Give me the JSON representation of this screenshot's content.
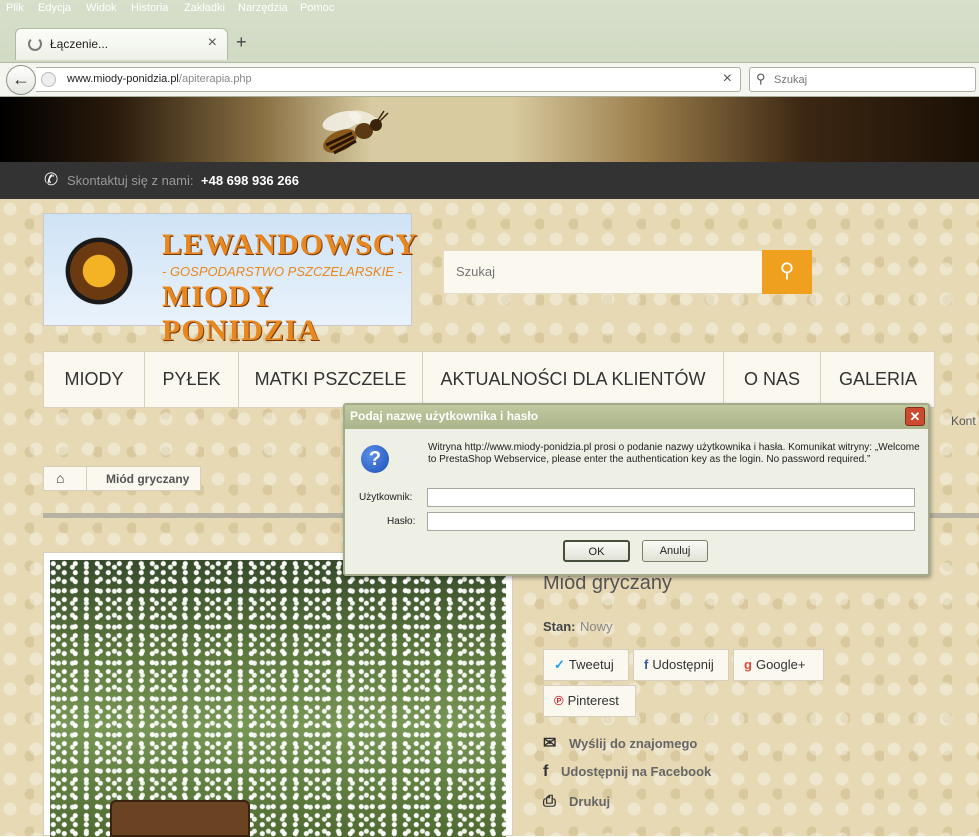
{
  "browser": {
    "menu": [
      "Plik",
      "Edycja",
      "Widok",
      "Historia",
      "Zakładki",
      "Narzędzia",
      "Pomoc"
    ],
    "tab_title": "Łączenie...",
    "tab_close": "×",
    "new_tab": "+",
    "back": "←",
    "url_domain": "www.miody-ponidzia.pl",
    "url_path": "/apiterapia.php",
    "url_clear": "×",
    "search_placeholder": "Szukaj"
  },
  "site": {
    "contact_label": "Skontaktuj się z nami:",
    "contact_phone": "+48 698 936 266",
    "logo_line1": "LEWANDOWSCY",
    "logo_line2": "- GOSPODARSTWO PSZCZELARSKIE -",
    "logo_line3": "MIODY PONIDZIA",
    "search_placeholder": "Szukaj",
    "menu": [
      "MIODY",
      "PYŁEK",
      "MATKI PSZCZELE",
      "AKTUALNOŚCI DLA KLIENTÓW",
      "O NAS",
      "GALERIA"
    ],
    "side_text": "Kont",
    "breadcrumb_current": "Miód gryczany",
    "product_title": "Miód gryczany",
    "condition_label": "Stan:",
    "condition_value": "Nowy",
    "share": {
      "twitter": "Tweetuj",
      "facebook": "Udostępnij",
      "google": "Google+",
      "pinterest": "Pinterest"
    },
    "actions": {
      "send": "Wyślij do znajomego",
      "facebook": "Udostępnij na Facebook",
      "print": "Drukuj"
    }
  },
  "dialog": {
    "title": "Podaj nazwę użytkownika i hasło",
    "message": "Witryna http://www.miody-ponidzia.pl prosi o podanie nazwy użytkownika i hasła. Komunikat witryny: „Welcome to PrestaShop Webservice, please enter the authentication key as the login. No password required.”",
    "user_label": "Użytkownik:",
    "password_label": "Hasło:",
    "user_value": "",
    "password_value": "",
    "ok": "OK",
    "cancel": "Anuluj",
    "close": "✕"
  }
}
